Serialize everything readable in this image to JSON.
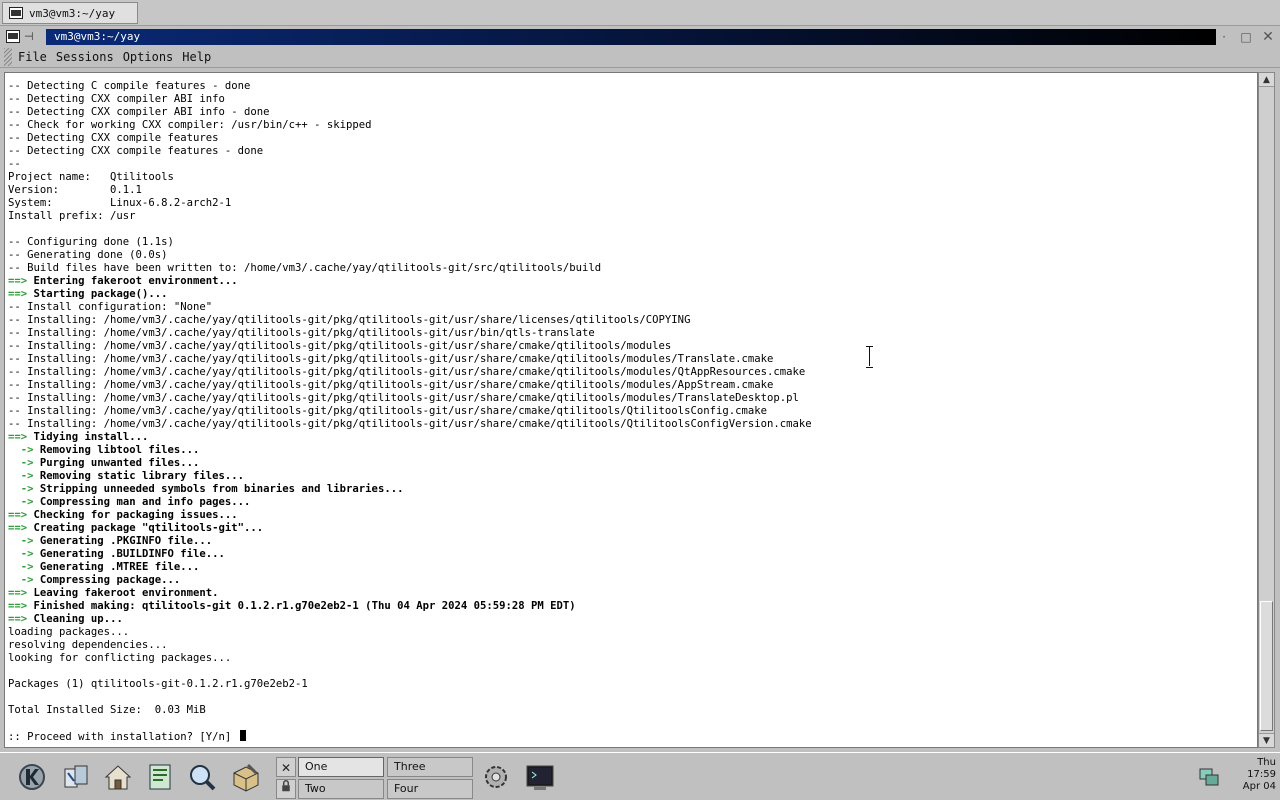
{
  "top_task": {
    "label": "vm3@vm3:~/yay"
  },
  "window": {
    "title": "vm3@vm3:~/yay",
    "pin_glyph": "⊣",
    "minimize_glyph": "·",
    "maximize_glyph": "□",
    "close_glyph": "✕"
  },
  "menu": [
    "File",
    "Sessions",
    "Options",
    "Help"
  ],
  "terminal": {
    "lines": [
      {
        "type": "plain",
        "text": "-- Detecting C compile features - done"
      },
      {
        "type": "plain",
        "text": "-- Detecting CXX compiler ABI info"
      },
      {
        "type": "plain",
        "text": "-- Detecting CXX compiler ABI info - done"
      },
      {
        "type": "plain",
        "text": "-- Check for working CXX compiler: /usr/bin/c++ - skipped"
      },
      {
        "type": "plain",
        "text": "-- Detecting CXX compile features"
      },
      {
        "type": "plain",
        "text": "-- Detecting CXX compile features - done"
      },
      {
        "type": "plain",
        "text": "--"
      },
      {
        "type": "plain",
        "text": "Project name:   Qtilitools"
      },
      {
        "type": "plain",
        "text": "Version:        0.1.1"
      },
      {
        "type": "plain",
        "text": "System:         Linux-6.8.2-arch2-1"
      },
      {
        "type": "plain",
        "text": "Install prefix: /usr"
      },
      {
        "type": "plain",
        "text": ""
      },
      {
        "type": "plain",
        "text": "-- Configuring done (1.1s)"
      },
      {
        "type": "plain",
        "text": "-- Generating done (0.0s)"
      },
      {
        "type": "plain",
        "text": "-- Build files have been written to: /home/vm3/.cache/yay/qtilitools-git/src/qtilitools/build"
      },
      {
        "type": "main",
        "text": "Entering fakeroot environment..."
      },
      {
        "type": "main",
        "text": "Starting package()..."
      },
      {
        "type": "plain",
        "text": "-- Install configuration: \"None\""
      },
      {
        "type": "plain",
        "text": "-- Installing: /home/vm3/.cache/yay/qtilitools-git/pkg/qtilitools-git/usr/share/licenses/qtilitools/COPYING"
      },
      {
        "type": "plain",
        "text": "-- Installing: /home/vm3/.cache/yay/qtilitools-git/pkg/qtilitools-git/usr/bin/qtls-translate"
      },
      {
        "type": "plain",
        "text": "-- Installing: /home/vm3/.cache/yay/qtilitools-git/pkg/qtilitools-git/usr/share/cmake/qtilitools/modules"
      },
      {
        "type": "plain",
        "text": "-- Installing: /home/vm3/.cache/yay/qtilitools-git/pkg/qtilitools-git/usr/share/cmake/qtilitools/modules/Translate.cmake"
      },
      {
        "type": "plain",
        "text": "-- Installing: /home/vm3/.cache/yay/qtilitools-git/pkg/qtilitools-git/usr/share/cmake/qtilitools/modules/QtAppResources.cmake"
      },
      {
        "type": "plain",
        "text": "-- Installing: /home/vm3/.cache/yay/qtilitools-git/pkg/qtilitools-git/usr/share/cmake/qtilitools/modules/AppStream.cmake"
      },
      {
        "type": "plain",
        "text": "-- Installing: /home/vm3/.cache/yay/qtilitools-git/pkg/qtilitools-git/usr/share/cmake/qtilitools/modules/TranslateDesktop.pl"
      },
      {
        "type": "plain",
        "text": "-- Installing: /home/vm3/.cache/yay/qtilitools-git/pkg/qtilitools-git/usr/share/cmake/qtilitools/QtilitoolsConfig.cmake"
      },
      {
        "type": "plain",
        "text": "-- Installing: /home/vm3/.cache/yay/qtilitools-git/pkg/qtilitools-git/usr/share/cmake/qtilitools/QtilitoolsConfigVersion.cmake"
      },
      {
        "type": "main",
        "text": "Tidying install..."
      },
      {
        "type": "sub",
        "text": "Removing libtool files..."
      },
      {
        "type": "sub",
        "text": "Purging unwanted files..."
      },
      {
        "type": "sub",
        "text": "Removing static library files..."
      },
      {
        "type": "sub",
        "text": "Stripping unneeded symbols from binaries and libraries..."
      },
      {
        "type": "sub",
        "text": "Compressing man and info pages..."
      },
      {
        "type": "main",
        "text": "Checking for packaging issues..."
      },
      {
        "type": "main",
        "text": "Creating package \"qtilitools-git\"..."
      },
      {
        "type": "sub",
        "text": "Generating .PKGINFO file..."
      },
      {
        "type": "sub",
        "text": "Generating .BUILDINFO file..."
      },
      {
        "type": "sub",
        "text": "Generating .MTREE file..."
      },
      {
        "type": "sub",
        "text": "Compressing package..."
      },
      {
        "type": "main",
        "text": "Leaving fakeroot environment."
      },
      {
        "type": "main",
        "text": "Finished making: qtilitools-git 0.1.2.r1.g70e2eb2-1 (Thu 04 Apr 2024 05:59:28 PM EDT)"
      },
      {
        "type": "main",
        "text": "Cleaning up..."
      },
      {
        "type": "plain",
        "text": "loading packages..."
      },
      {
        "type": "plain",
        "text": "resolving dependencies..."
      },
      {
        "type": "plain",
        "text": "looking for conflicting packages..."
      },
      {
        "type": "plain",
        "text": ""
      },
      {
        "type": "plain",
        "text": "Packages (1) qtilitools-git-0.1.2.r1.g70e2eb2-1"
      },
      {
        "type": "plain",
        "text": ""
      },
      {
        "type": "plain",
        "text": "Total Installed Size:  0.03 MiB"
      },
      {
        "type": "plain",
        "text": ""
      },
      {
        "type": "prompt",
        "text": ":: Proceed with installation? [Y/n] "
      }
    ],
    "arrow_main": "==>",
    "arrow_sub": "  ->",
    "scrollbar": {
      "position_fraction": 0.88
    }
  },
  "panel": {
    "launchers": [
      "k-menu-icon",
      "desktop-pager-icon",
      "home-folder-icon",
      "text-editor-icon",
      "find-files-icon",
      "package-tool-icon"
    ],
    "virtual_desktops": [
      "One",
      "Two",
      "Three",
      "Four"
    ],
    "close_glyph": "✕",
    "lock_glyph": "🔒",
    "clock": {
      "day": "Thu",
      "time": "17:59",
      "date": "Apr 04"
    }
  },
  "colors": {
    "arrow_green": "#2e9e3a",
    "title_blue": "#0a2a78",
    "terminal_bg": "#ffffff"
  }
}
